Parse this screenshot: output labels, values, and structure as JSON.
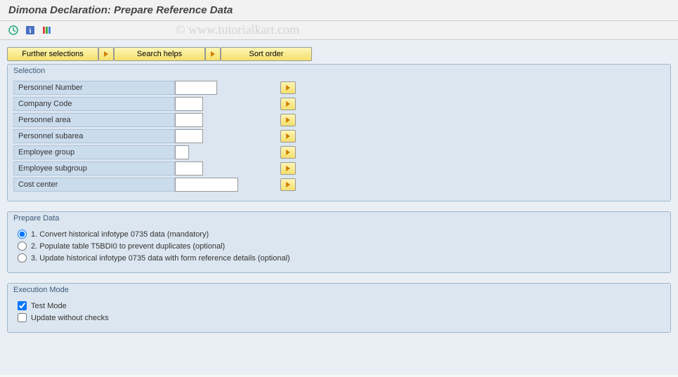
{
  "header": {
    "title": "Dimona Declaration: Prepare Reference Data"
  },
  "watermark": "© www.tutorialkart.com",
  "topButtons": {
    "further_selections": "Further selections",
    "search_helps": "Search helps",
    "sort_order": "Sort order"
  },
  "groups": {
    "selection": {
      "title": "Selection",
      "fields": {
        "personnel_number": "Personnel Number",
        "company_code": "Company Code",
        "personnel_area": "Personnel area",
        "personnel_subarea": "Personnel subarea",
        "employee_group": "Employee group",
        "employee_subgroup": "Employee subgroup",
        "cost_center": "Cost center"
      }
    },
    "prepare_data": {
      "title": "Prepare Data",
      "options": {
        "opt1": "1. Convert historical infotype 0735 data (mandatory)",
        "opt2": "2. Populate table T5BDI0 to prevent duplicates (optional)",
        "opt3": "3. Update historical infotype 0735 data with form reference details (optional)"
      }
    },
    "execution_mode": {
      "title": "Execution Mode",
      "test_mode": "Test Mode",
      "update_without_checks": "Update without checks"
    }
  }
}
